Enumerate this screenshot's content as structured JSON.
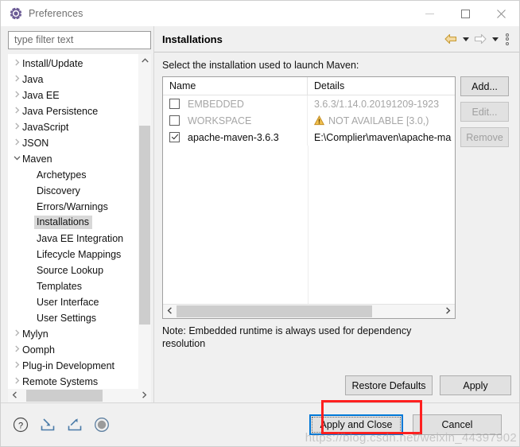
{
  "window": {
    "title": "Preferences",
    "icon": "preferences-gear-icon",
    "controls": {
      "minimize": "—",
      "maximize": "□",
      "close": "✕"
    }
  },
  "sidebar": {
    "filter": {
      "placeholder": "type filter text",
      "value": ""
    },
    "items": [
      {
        "label": "Install/Update",
        "level": 0,
        "expandable": true,
        "expanded": false,
        "selected": false
      },
      {
        "label": "Java",
        "level": 0,
        "expandable": true,
        "expanded": false,
        "selected": false
      },
      {
        "label": "Java EE",
        "level": 0,
        "expandable": true,
        "expanded": false,
        "selected": false
      },
      {
        "label": "Java Persistence",
        "level": 0,
        "expandable": true,
        "expanded": false,
        "selected": false
      },
      {
        "label": "JavaScript",
        "level": 0,
        "expandable": true,
        "expanded": false,
        "selected": false
      },
      {
        "label": "JSON",
        "level": 0,
        "expandable": true,
        "expanded": false,
        "selected": false
      },
      {
        "label": "Maven",
        "level": 0,
        "expandable": true,
        "expanded": true,
        "selected": false
      },
      {
        "label": "Archetypes",
        "level": 1,
        "expandable": false,
        "expanded": false,
        "selected": false
      },
      {
        "label": "Discovery",
        "level": 1,
        "expandable": false,
        "expanded": false,
        "selected": false
      },
      {
        "label": "Errors/Warnings",
        "level": 1,
        "expandable": false,
        "expanded": false,
        "selected": false
      },
      {
        "label": "Installations",
        "level": 1,
        "expandable": false,
        "expanded": false,
        "selected": true
      },
      {
        "label": "Java EE Integration",
        "level": 1,
        "expandable": false,
        "expanded": false,
        "selected": false
      },
      {
        "label": "Lifecycle Mappings",
        "level": 1,
        "expandable": false,
        "expanded": false,
        "selected": false
      },
      {
        "label": "Source Lookup",
        "level": 1,
        "expandable": false,
        "expanded": false,
        "selected": false
      },
      {
        "label": "Templates",
        "level": 1,
        "expandable": false,
        "expanded": false,
        "selected": false
      },
      {
        "label": "User Interface",
        "level": 1,
        "expandable": false,
        "expanded": false,
        "selected": false
      },
      {
        "label": "User Settings",
        "level": 1,
        "expandable": false,
        "expanded": false,
        "selected": false
      },
      {
        "label": "Mylyn",
        "level": 0,
        "expandable": true,
        "expanded": false,
        "selected": false
      },
      {
        "label": "Oomph",
        "level": 0,
        "expandable": true,
        "expanded": false,
        "selected": false
      },
      {
        "label": "Plug-in Development",
        "level": 0,
        "expandable": true,
        "expanded": false,
        "selected": false
      },
      {
        "label": "Remote Systems",
        "level": 0,
        "expandable": true,
        "expanded": false,
        "selected": false
      }
    ]
  },
  "page": {
    "title": "Installations",
    "toolbar": {
      "back_icon": "back-arrow-icon",
      "back_menu_icon": "chevron-down-icon",
      "forward_icon": "forward-arrow-icon",
      "forward_menu_icon": "chevron-down-icon",
      "menu_icon": "view-menu-dots-icon"
    },
    "instruction": "Select the installation used to launch Maven:",
    "table": {
      "columns": [
        "Name",
        "Details"
      ],
      "rows": [
        {
          "checked": false,
          "name": "EMBEDDED",
          "details": "3.6.3/1.14.0.20191209-1923",
          "warning": false,
          "dim": true
        },
        {
          "checked": false,
          "name": "WORKSPACE",
          "details": "NOT AVAILABLE [3.0,)",
          "warning": true,
          "dim": true
        },
        {
          "checked": true,
          "name": "apache-maven-3.6.3",
          "details": "E:\\Complier\\maven\\apache-ma",
          "warning": false,
          "dim": false
        }
      ],
      "empty_row_count": 10,
      "hscroll": {
        "left_arrow": "‹",
        "right_arrow": "›"
      }
    },
    "side_buttons": [
      {
        "label": "Add...",
        "enabled": true
      },
      {
        "label": "Edit...",
        "enabled": false
      },
      {
        "label": "Remove",
        "enabled": false
      }
    ],
    "note": "Note: Embedded runtime is always used for dependency resolution",
    "footer_buttons": [
      {
        "label": "Restore Defaults",
        "enabled": true
      },
      {
        "label": "Apply",
        "enabled": true
      }
    ]
  },
  "bottom": {
    "icons": [
      {
        "name": "help-icon",
        "title": "Help"
      },
      {
        "name": "import-icon",
        "title": "Import"
      },
      {
        "name": "export-icon",
        "title": "Export"
      },
      {
        "name": "record-icon",
        "title": "Record"
      }
    ],
    "buttons": [
      {
        "label": "Apply and Close",
        "focused": true,
        "highlighted": true
      },
      {
        "label": "Cancel",
        "focused": false,
        "highlighted": false
      }
    ]
  },
  "annotation": {
    "color": "#ff2020",
    "target": "Apply and Close"
  },
  "watermark": {
    "text": "https://blog.csdn.net/weixin_44397902"
  },
  "colors": {
    "accent_blue": "#0078d7",
    "warning_amber": "#e8a33d",
    "back_arrow_gold": "#d9a441",
    "annotation_red": "#ff2020",
    "selection_grey": "#d8d8d8"
  }
}
